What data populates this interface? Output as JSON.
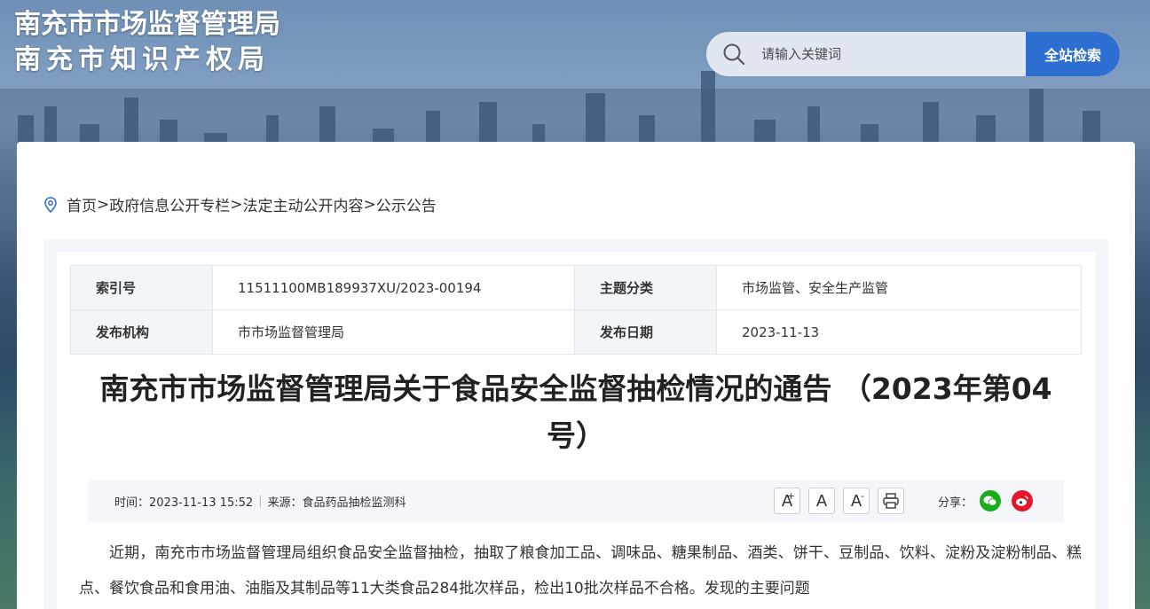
{
  "header": {
    "title_line1": "南充市市场监督管理局",
    "title_line2": "南充市知识产权局",
    "search": {
      "placeholder": "请输入关键词",
      "button_label": "全站检索",
      "icon": "search-icon"
    }
  },
  "breadcrumb": {
    "icon": "location-pin-icon",
    "items": [
      "首页",
      "政府信息公开专栏",
      "法定主动公开内容",
      "公示公告"
    ],
    "separator": ">"
  },
  "meta": {
    "index_label": "索引号",
    "index_value": "11511100MB189937XU/2023-00194",
    "category_label": "主题分类",
    "category_value": "市场监管、安全生产监管",
    "publisher_label": "发布机构",
    "publisher_value": "市市场监督管理局",
    "date_label": "发布日期",
    "date_value": "2023-11-13"
  },
  "article": {
    "title": "南充市市场监督管理局关于食品安全监督抽检情况的通告 （2023年第04号）",
    "time": "时间：2023-11-13 15:52",
    "source": "来源：食品药品抽检监测科",
    "font_buttons": [
      "A",
      "A",
      "A"
    ],
    "share_label": "分享：",
    "share_icons": [
      "wechat-icon",
      "weibo-icon"
    ],
    "body": "近期，南充市市场监督管理局组织食品安全监督抽检，抽取了粮食加工品、调味品、糖果制品、酒类、饼干、豆制品、饮料、淀粉及淀粉制品、糕点、餐饮食品和食用油、油脂及其制品等11大类食品284批次样品，检出10批次样品不合格。发现的主要问题"
  },
  "colors": {
    "accent": "#2c6fd1",
    "wechat": "#1aad19",
    "weibo": "#e6162d"
  }
}
